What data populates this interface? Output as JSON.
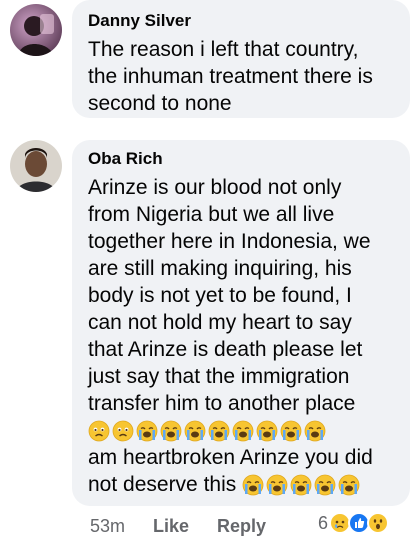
{
  "comments": [
    {
      "author": "Danny Silver",
      "lines": [
        "The reason i left that country,",
        "the inhuman treatment there is",
        "second to none"
      ]
    },
    {
      "author": "Oba Rich",
      "lines": [
        "Arinze is our blood not only",
        "from Nigeria but we all live",
        "together here in Indonesia, we",
        "are still making inquiring, his",
        "body is not yet to be found, I",
        "can not hold my heart to say",
        "that Arinze is death please let",
        "just say that the immigration",
        "transfer him to another place"
      ],
      "emoji_line_1": [
        "sad-face-icon",
        "sad-face-icon",
        "crying-face-icon",
        "crying-face-icon",
        "crying-face-icon",
        "crying-face-icon",
        "crying-face-icon",
        "crying-face-icon",
        "crying-face-icon",
        "crying-face-icon"
      ],
      "tail_lines": [
        "am heartbroken Arinze you did",
        "not deserve this"
      ],
      "emoji_line_2": [
        "crying-face-icon",
        "crying-face-icon",
        "crying-face-icon",
        "crying-face-icon",
        "crying-face-icon"
      ],
      "time": "53m",
      "like_label": "Like",
      "reply_label": "Reply",
      "reaction_count": "6",
      "reaction_icons": [
        "sad-reaction-icon",
        "like-reaction-icon",
        "wow-reaction-icon"
      ]
    }
  ],
  "colors": {
    "bubble": "#f0f2f5",
    "meta_text": "#65676b",
    "like_blue": "#1877f2",
    "emoji_yellow": "#f7c531"
  }
}
